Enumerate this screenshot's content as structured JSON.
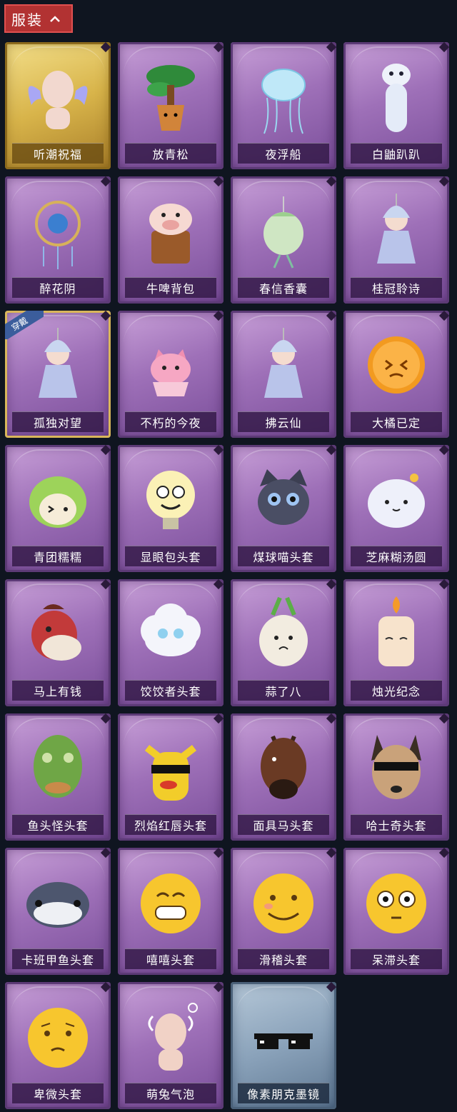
{
  "header": {
    "title": "服装"
  },
  "badge_text": "穿戴",
  "items": [
    {
      "name": "听潮祝福",
      "style": "gold",
      "art": "angel-wings-icon"
    },
    {
      "name": "放青松",
      "style": "purple",
      "art": "bonsai-icon"
    },
    {
      "name": "夜浮船",
      "style": "purple",
      "art": "jellyfish-icon"
    },
    {
      "name": "白鼬趴趴",
      "style": "purple",
      "art": "ferret-icon"
    },
    {
      "name": "醉花阴",
      "style": "purple",
      "art": "dreamcatcher-icon"
    },
    {
      "name": "牛啤背包",
      "style": "purple",
      "art": "cow-mug-icon"
    },
    {
      "name": "春信香囊",
      "style": "purple",
      "art": "sachet-icon"
    },
    {
      "name": "桂冠聆诗",
      "style": "purple",
      "art": "doll-charm-icon"
    },
    {
      "name": "孤独对望",
      "style": "equipped",
      "art": "doll-charm-icon"
    },
    {
      "name": "不朽的今夜",
      "style": "purple",
      "art": "pink-fox-icon"
    },
    {
      "name": "拂云仙",
      "style": "purple",
      "art": "doll-charm-icon"
    },
    {
      "name": "大橘已定",
      "style": "purple",
      "art": "orange-slice-icon"
    },
    {
      "name": "青团糯糯",
      "style": "purple",
      "art": "green-mochi-icon"
    },
    {
      "name": "显眼包头套",
      "style": "purple",
      "art": "lightbulb-head-icon"
    },
    {
      "name": "煤球喵头套",
      "style": "purple",
      "art": "black-cat-head-icon"
    },
    {
      "name": "芝麻糊汤圆",
      "style": "purple",
      "art": "dumpling-head-icon"
    },
    {
      "name": "马上有钱",
      "style": "purple",
      "art": "red-horse-head-icon"
    },
    {
      "name": "饺饺者头套",
      "style": "purple",
      "art": "cloud-head-icon"
    },
    {
      "name": "蒜了八",
      "style": "purple",
      "art": "garlic-head-icon"
    },
    {
      "name": "烛光纪念",
      "style": "purple",
      "art": "candle-head-icon"
    },
    {
      "name": "鱼头怪头套",
      "style": "purple",
      "art": "fish-mask-icon"
    },
    {
      "name": "烈焰红唇头套",
      "style": "purple",
      "art": "yellow-mascot-icon"
    },
    {
      "name": "面具马头套",
      "style": "purple",
      "art": "horse-mask-icon"
    },
    {
      "name": "哈士奇头套",
      "style": "purple",
      "art": "husky-mask-icon"
    },
    {
      "name": "卡班甲鱼头套",
      "style": "purple",
      "art": "fish-head-icon"
    },
    {
      "name": "嘻嘻头套",
      "style": "purple",
      "art": "grin-emoji-icon"
    },
    {
      "name": "滑稽头套",
      "style": "purple",
      "art": "smirk-emoji-icon"
    },
    {
      "name": "呆滞头套",
      "style": "purple",
      "art": "dazed-emoji-icon"
    },
    {
      "name": "卑微头套",
      "style": "purple",
      "art": "shy-emoji-icon"
    },
    {
      "name": "萌兔气泡",
      "style": "purple",
      "art": "bunny-bubble-icon"
    },
    {
      "name": "像素朋克墨镜",
      "style": "blue",
      "art": "pixel-sunglasses-icon"
    }
  ]
}
